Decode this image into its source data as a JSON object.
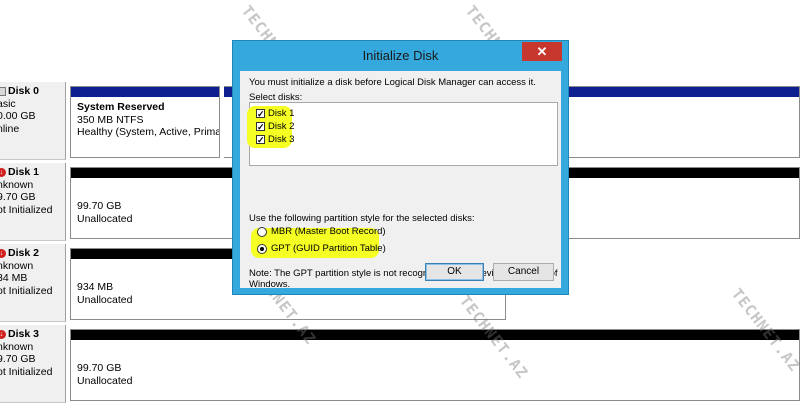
{
  "disks": [
    {
      "name": "Disk 0",
      "type": "asic",
      "size": "0.00 GB",
      "status": "nline",
      "error": false,
      "partition": {
        "title": "System Reserved",
        "line1": "350 MB NTFS",
        "line2": "Healthy (System, Active, Primary Par",
        "bar_color": "#0e1f8f"
      }
    },
    {
      "name": "Disk 1",
      "type": "nknown",
      "size": "9.70 GB",
      "status": "ot Initialized",
      "error": true,
      "partition": {
        "title": "",
        "line1": "99.70 GB",
        "line2": "Unallocated",
        "bar_color": "#000000"
      }
    },
    {
      "name": "Disk 2",
      "type": "nknown",
      "size": "34 MB",
      "status": "ot Initialized",
      "error": true,
      "partition": {
        "title": "",
        "line1": "934 MB",
        "line2": "Unallocated",
        "bar_color": "#000000"
      }
    },
    {
      "name": "Disk 3",
      "type": "nknown",
      "size": "9.70 GB",
      "status": "ot Initialized",
      "error": true,
      "partition": {
        "title": "",
        "line1": "99.70 GB",
        "line2": "Unallocated",
        "bar_color": "#000000"
      }
    }
  ],
  "watermark": "TECHNET.AZ",
  "dialog": {
    "title": "Initialize Disk",
    "close_label": "✕",
    "intro": "You must initialize a disk before Logical Disk Manager can access it.",
    "select_label": "Select disks:",
    "disks": [
      {
        "label": "Disk 1",
        "checked": true
      },
      {
        "label": "Disk 2",
        "checked": true
      },
      {
        "label": "Disk 3",
        "checked": true
      }
    ],
    "style_label": "Use the following partition style for the selected disks:",
    "styles": [
      {
        "label": "MBR (Master Boot Record)",
        "selected": false
      },
      {
        "label": "GPT (GUID Partition Table)",
        "selected": true
      }
    ],
    "note_line1": "Note: The GPT partition style is not recognized by all previous versions of",
    "note_line2": "Windows.",
    "ok_label": "OK",
    "cancel_label": "Cancel"
  },
  "colors": {
    "dialog_frame": "#35a9dd",
    "close_button": "#c7372e",
    "highlight": "#f5ff24",
    "system_bar": "#0e1f8f"
  }
}
